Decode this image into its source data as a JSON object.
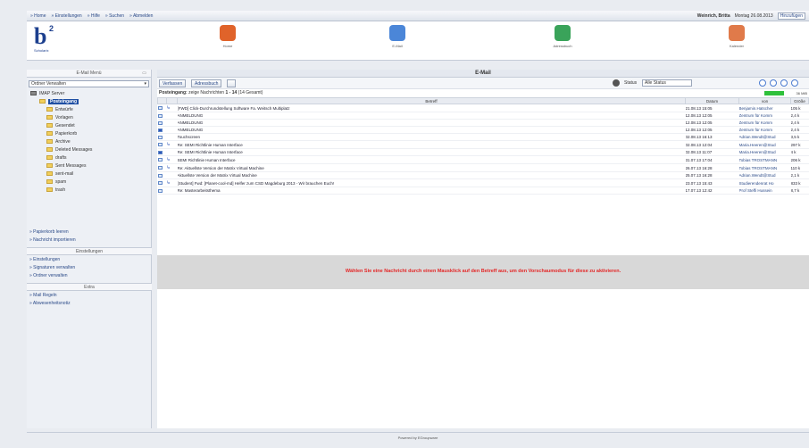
{
  "topnav": {
    "items": [
      "» Home",
      "» Einstellungen",
      "» Hilfe",
      "» Suchen",
      "» Abmelden"
    ],
    "user": "Weinrich, Britta",
    "date": "Montag 26.08.2013",
    "lang": "Hinzufügen"
  },
  "header": {
    "logo_text": "b",
    "logo_sup": "2",
    "logo_tag": "Scholarix",
    "nav": [
      {
        "label": "Home",
        "icon": "home-icon",
        "color": "#e0632a"
      },
      {
        "label": "E-Mail",
        "icon": "email-icon",
        "color": "#4b86d8"
      },
      {
        "label": "Adressbuch",
        "icon": "addressbook-icon",
        "color": "#3aa35a"
      },
      {
        "label": "Kalender",
        "icon": "calendar-icon",
        "color": "#e07a4a"
      }
    ]
  },
  "sidebar": {
    "title": "E-Mail Menü",
    "folder_select": "Ordner Verwalten",
    "root": "IMAP Server",
    "folders": [
      "Posteingang",
      "Entwürfe",
      "Vorlagen",
      "Gesendet",
      "Papierkorb",
      "Archive",
      "Deleted Messages",
      "drafts",
      "Sent Messages",
      "sent-mail",
      "spam",
      "trash"
    ],
    "links1": [
      "» Papierkorb leeren",
      "» Nachricht importieren"
    ],
    "section2": "Einstellungen",
    "links2": [
      "» Einstellungen",
      "» Signaturen verwalten",
      "» Ordner verwalten"
    ],
    "section3": "Extra",
    "links3": [
      "» Mail Regeln",
      "» Abwesenheitsnotiz"
    ]
  },
  "main": {
    "title": "E-Mail",
    "toolbar": {
      "compose": "Verfassen",
      "addressbook": "Adressbuch",
      "status_label": "Status",
      "status_value": "Alle Status"
    },
    "info": {
      "folder_label": "Posteingang:",
      "text": "zeige Nachrichten",
      "range": "1 - 14",
      "total": "(14 Gesamt)",
      "quota": "36 MiB"
    },
    "columns": [
      "",
      "",
      "Betreff",
      "Datum",
      "von",
      "Größe"
    ],
    "rows": [
      {
        "subject": "[FWD] Click-Durchrundstellung Software Fa. Weitsch Multiplatz",
        "date": "21.08.13 15:05",
        "from": "Benjamin.Hatscher",
        "size": "105 k",
        "flag": false,
        "reply": true
      },
      {
        "subject": "ANMELDUNG",
        "date": "12.08.13 12:05",
        "from": "Zentrum für Komm",
        "size": "2,4 k",
        "flag": false,
        "reply": false
      },
      {
        "subject": "ANMELDUNG",
        "date": "12.08.13 12:05",
        "from": "Zentrum für Komm",
        "size": "2,4 k",
        "flag": false,
        "reply": false
      },
      {
        "subject": "ANMELDUNG",
        "date": "12.08.13 12:05",
        "from": "Zentrum für Komm",
        "size": "2,4 k",
        "flag": true,
        "reply": false
      },
      {
        "subject": "Touchscreen",
        "date": "02.08.13 16:13",
        "from": "Adrian.Wendt@Stud",
        "size": "3,5 k",
        "flag": false,
        "reply": false
      },
      {
        "subject": "Re: SEMI Richtlinie Human Interface",
        "date": "02.08.13 12:04",
        "from": "Maria.Heeren@Stud",
        "size": "297 k",
        "flag": false,
        "reply": true
      },
      {
        "subject": "Re: SEMI Richtlinie Human Interface",
        "date": "02.08.13 11:07",
        "from": "Maria.Heeren@Stud",
        "size": "4 k",
        "flag": true,
        "reply": false
      },
      {
        "subject": "SEMI Richtlinie Human Interface",
        "date": "31.07.13 17:04",
        "from": "Tobias TROSTMANN",
        "size": "206 k",
        "flag": false,
        "reply": true
      },
      {
        "subject": "Re: Aktuellste Version der Matrix Virtual Machine",
        "date": "26.07.13 16:28",
        "from": "Tobias TROSTMANN",
        "size": "110 k",
        "flag": false,
        "reply": true
      },
      {
        "subject": "Aktuellste Version der Matrix Virtual Machine",
        "date": "25.07.13 16:28",
        "from": "Adrian.Wendt@Stud",
        "size": "2,1 k",
        "flag": false,
        "reply": false
      },
      {
        "subject": "[Student] Fwd: [Planet-cool-md] Helfer zum CSD Magdeburg 2013 - Wir brauchen Euch!",
        "date": "23.07.13 15:43",
        "from": "Studierendenrat Ho",
        "size": "833 k",
        "flag": false,
        "reply": true
      },
      {
        "subject": "Re: Masterarbeitsthema",
        "date": "17.07.13 12:42",
        "from": "Prof Steffi Hussein",
        "size": "8,7 k",
        "flag": false,
        "reply": false
      }
    ],
    "preview_msg": "Wählen Sie eine Nachricht durch einen Mausklick auf den Betreff aus, um den Vorschaumodus für diese zu aktivieren."
  },
  "footer": "Powered by EGroupware"
}
